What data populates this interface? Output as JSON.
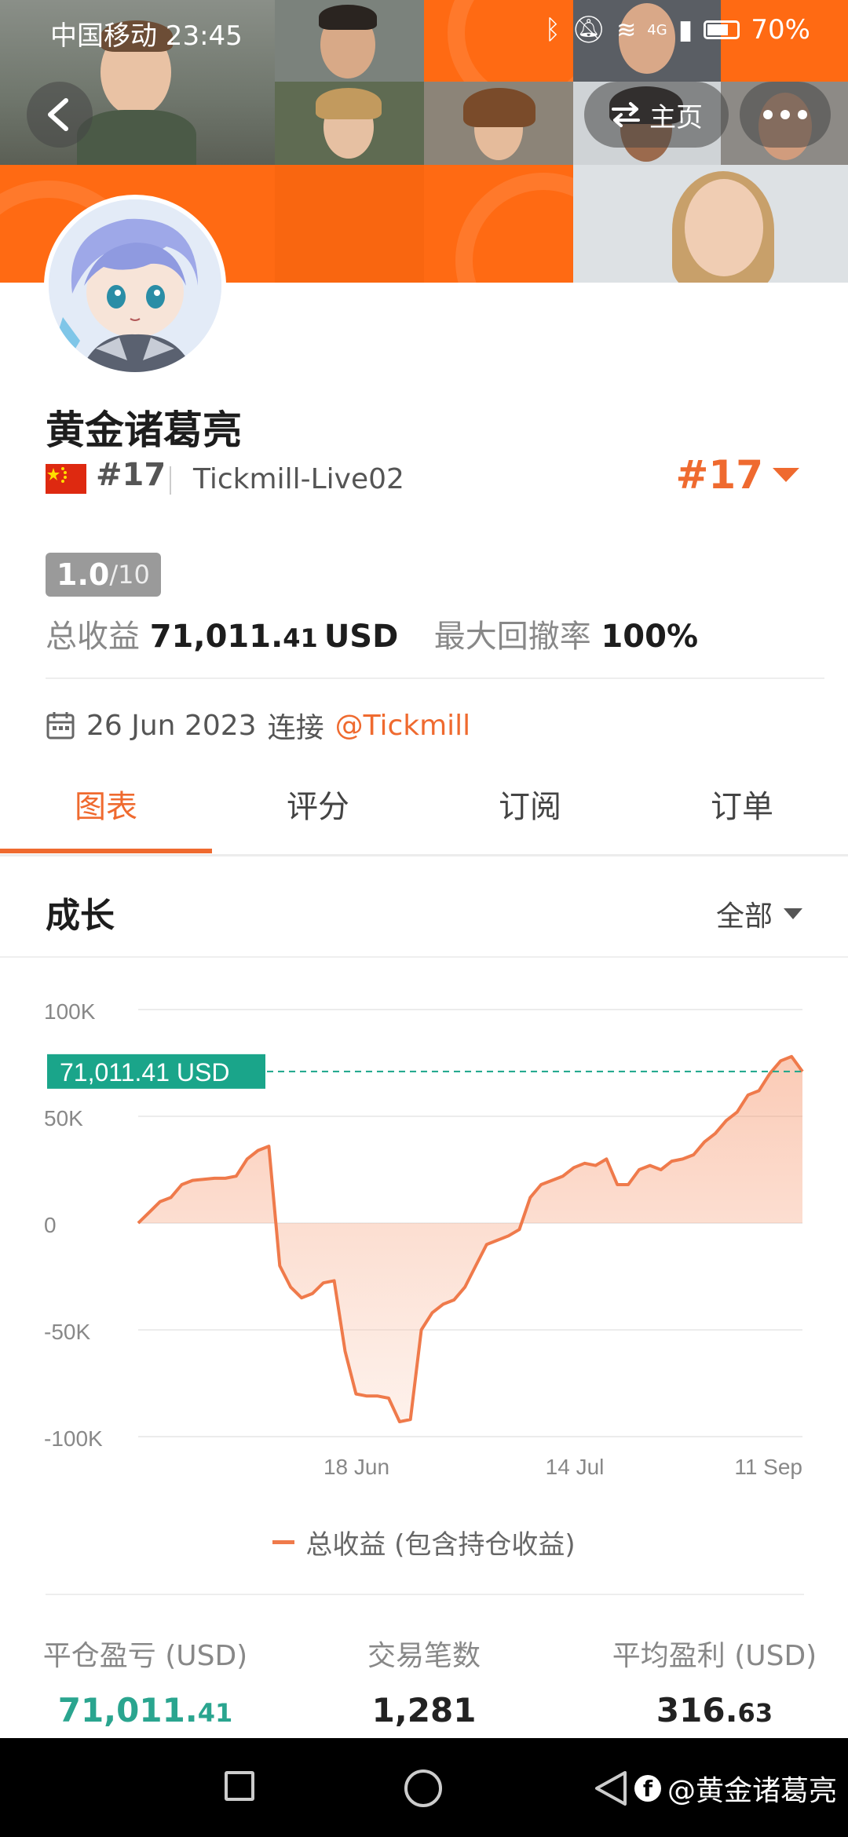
{
  "status_bar": {
    "carrier_time": "中国移动 23:45",
    "network": "4G",
    "battery": "70%"
  },
  "header": {
    "home_label": "主页"
  },
  "profile": {
    "name": "黄金诸葛亮",
    "country_flag": "china-flag-icon",
    "rank": "#17",
    "broker": "Tickmill-Live02",
    "rank_highlight": "#17",
    "score": "1.0",
    "score_max": "/10",
    "total_profit_label": "总收益",
    "total_profit_int": "71,011.",
    "total_profit_dec": "41",
    "total_profit_unit": "USD",
    "max_drawdown_label": "最大回撤率",
    "max_drawdown": "100%",
    "joined_date": "26 Jun 2023",
    "joined_text": "连接",
    "joined_link": "@Tickmill"
  },
  "tabs": [
    {
      "label": "图表",
      "active": true
    },
    {
      "label": "评分",
      "active": false
    },
    {
      "label": "订阅",
      "active": false
    },
    {
      "label": "订单",
      "active": false
    }
  ],
  "growth": {
    "title": "成长",
    "range": "全部"
  },
  "chart_data": {
    "type": "area",
    "y_ticks": [
      "100K",
      "50K",
      "0",
      "-50K",
      "-100K"
    ],
    "ylim": [
      -100000,
      100000
    ],
    "x_ticks": [
      "18 Jun",
      "14 Jul",
      "11 Sep"
    ],
    "current_value_label": "71,011.41 USD",
    "current_value": 71011.41,
    "series": [
      {
        "name": "总收益 (包含持仓收益)",
        "color": "#ef7a4b",
        "values": [
          0,
          5000,
          10000,
          12000,
          18000,
          20000,
          20500,
          21000,
          21000,
          22000,
          30000,
          34000,
          36000,
          -20000,
          -30000,
          -35000,
          -33000,
          -28000,
          -27000,
          -60000,
          -80000,
          -81000,
          -81000,
          -82000,
          -93000,
          -92000,
          -50000,
          -42000,
          -38000,
          -36000,
          -30000,
          -20000,
          -10000,
          -8000,
          -6000,
          -3000,
          12000,
          18000,
          20000,
          22000,
          26000,
          28000,
          27000,
          30000,
          18000,
          18000,
          25000,
          27000,
          25000,
          29000,
          30000,
          32000,
          38000,
          42000,
          48000,
          52000,
          60000,
          62000,
          70000,
          76000,
          78000,
          71011
        ]
      }
    ]
  },
  "metrics": [
    {
      "label": "平仓盈亏 (USD)",
      "value_int": "71,011.",
      "value_dec": "41",
      "color": "#2aa58f"
    },
    {
      "label": "交易笔数",
      "value_int": "1,281",
      "value_dec": "",
      "color": "#222222"
    },
    {
      "label": "平均盈利 (USD)",
      "value_int": "316.",
      "value_dec": "63",
      "color": "#222222"
    }
  ],
  "watermark": "@黄金诸葛亮",
  "colors": {
    "accent": "#ef6a2f",
    "banner_orange": "#ff6a13",
    "positive_green": "#2aa58f"
  }
}
